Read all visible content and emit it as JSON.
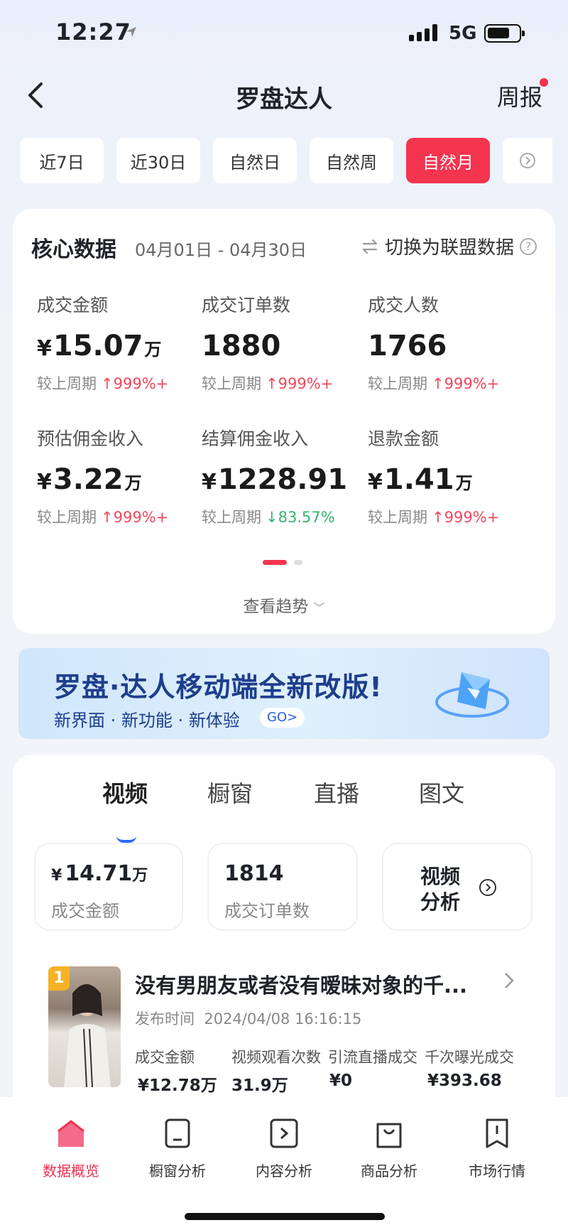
{
  "status": {
    "time": "12:27",
    "network": "5G"
  },
  "nav": {
    "title": "罗盘达人",
    "right_label": "周报"
  },
  "period_tabs": [
    "近7日",
    "近30日",
    "自然日",
    "自然周",
    "自然月"
  ],
  "period_active": "自然月",
  "core": {
    "title": "核心数据",
    "range": "04月01日 - 04月30日",
    "switch_label": "切换为联盟数据",
    "compare_label": "较上周期",
    "metrics": [
      {
        "label": "成交金额",
        "prefix": "¥",
        "value": "15.07",
        "unit": "万",
        "change": "999%+",
        "dir": "up"
      },
      {
        "label": "成交订单数",
        "prefix": "",
        "value": "1880",
        "unit": "",
        "change": "999%+",
        "dir": "up"
      },
      {
        "label": "成交人数",
        "prefix": "",
        "value": "1766",
        "unit": "",
        "change": "999%+",
        "dir": "up"
      },
      {
        "label": "预估佣金收入",
        "prefix": "¥",
        "value": "3.22",
        "unit": "万",
        "change": "999%+",
        "dir": "up"
      },
      {
        "label": "结算佣金收入",
        "prefix": "¥",
        "value": "1228.91",
        "unit": "",
        "change": "83.57%",
        "dir": "down"
      },
      {
        "label": "退款金额",
        "prefix": "¥",
        "value": "1.41",
        "unit": "万",
        "change": "999%+",
        "dir": "up"
      }
    ],
    "trend_link": "查看趋势"
  },
  "banner": {
    "title": "罗盘·达人移动端全新改版!",
    "subtitle": "新界面 · 新功能 · 新体验",
    "go_label": "GO>"
  },
  "content": {
    "tabs": [
      "视频",
      "橱窗",
      "直播",
      "图文"
    ],
    "active_tab": "视频",
    "stats": [
      {
        "prefix": "¥",
        "value": "14.71",
        "unit": "万",
        "label": "成交金额"
      },
      {
        "prefix": "",
        "value": "1814",
        "unit": "",
        "label": "成交订单数"
      }
    ],
    "analysis_link": "视频分析",
    "video": {
      "rank": "1",
      "title": "没有男朋友或者没有暧昧对象的千...",
      "publish_label": "发布时间",
      "publish_time": "2024/04/08 16:16:15",
      "stats": [
        {
          "label": "成交金额",
          "prefix": "¥",
          "value": "12.78",
          "unit": "万"
        },
        {
          "label": "视频观看次数",
          "prefix": "",
          "value": "31.9",
          "unit": "万"
        },
        {
          "label": "引流直播成交",
          "prefix": "¥",
          "value": "0",
          "unit": ""
        },
        {
          "label": "千次曝光成交",
          "prefix": "¥",
          "value": "393.68",
          "unit": ""
        }
      ]
    }
  },
  "tabbar": {
    "items": [
      "数据概览",
      "橱窗分析",
      "内容分析",
      "商品分析",
      "市场行情"
    ],
    "active": "数据概览"
  },
  "colors": {
    "accent": "#f5344f",
    "up": "#f0475b",
    "down": "#34b36a",
    "link_blue": "#2a6af3",
    "banner_text": "#1e3e8c"
  }
}
